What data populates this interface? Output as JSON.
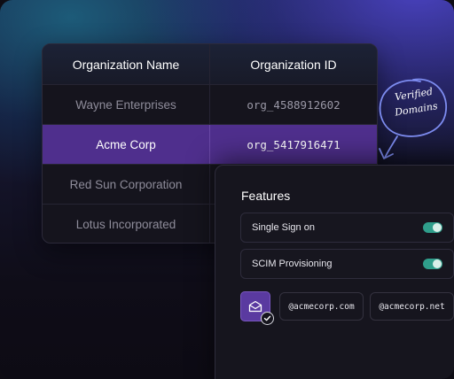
{
  "org_table": {
    "headers": {
      "name": "Organization Name",
      "id": "Organization ID"
    },
    "rows": [
      {
        "name": "Wayne Enterprises",
        "id": "org_4588912602",
        "selected": false
      },
      {
        "name": "Acme Corp",
        "id": "org_5417916471",
        "selected": true
      },
      {
        "name": "Red Sun Corporation",
        "id": "",
        "selected": false
      },
      {
        "name": "Lotus Incorporated",
        "id": "",
        "selected": false
      }
    ]
  },
  "annotation": {
    "text_line1": "Verified",
    "text_line2": "Domains",
    "icon": "hand-drawn-circle-arrow"
  },
  "features": {
    "title": "Features",
    "items": [
      {
        "label": "Single Sign on",
        "enabled": true
      },
      {
        "label": "SCIM Provisioning",
        "enabled": true
      }
    ],
    "domains": [
      "@acmecorp.com",
      "@acmecorp.net"
    ],
    "domain_icon": "mail-icon",
    "verified_icon": "check-icon"
  },
  "colors": {
    "selected_row": "#4f2f8d",
    "toggle_on": "#2f9e8b",
    "domain_icon_bg": "#5a3aa0"
  }
}
